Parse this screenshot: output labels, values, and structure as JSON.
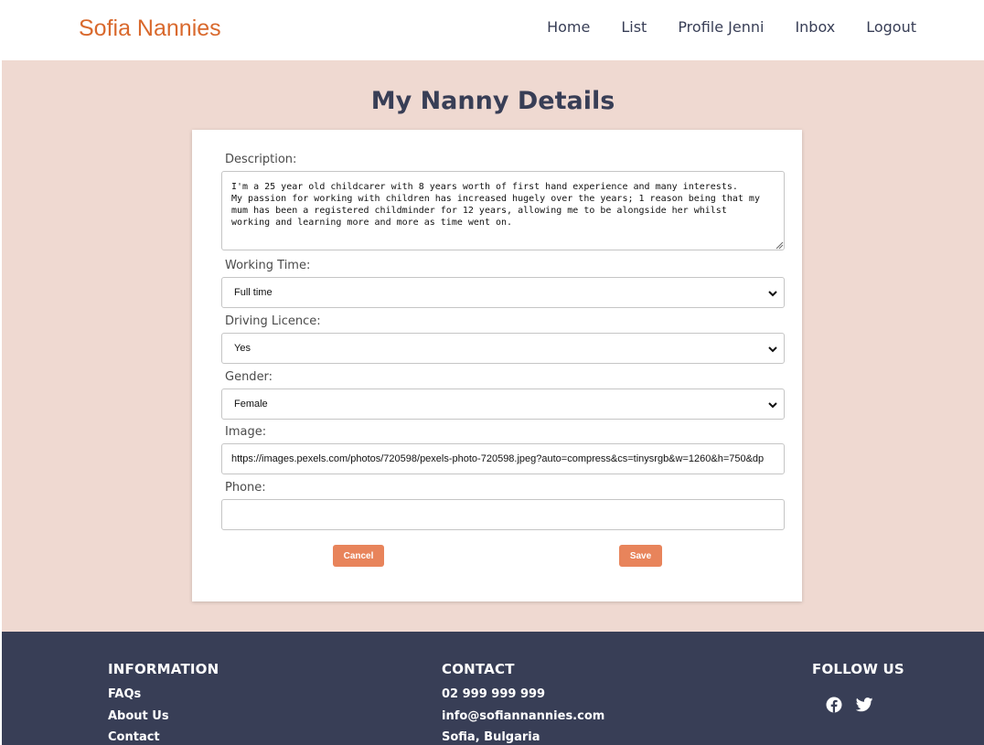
{
  "header": {
    "brand": "Sofia Nannies",
    "nav": [
      "Home",
      "List",
      "Profile Jenni",
      "Inbox",
      "Logout"
    ]
  },
  "main": {
    "title": "My Nanny Details",
    "form": {
      "description_label": "Description:",
      "description_value": "I'm a 25 year old childcarer with 8 years worth of first hand experience and many interests.\nMy passion for working with children has increased hugely over the years; 1 reason being that my\nmum has been a registered childminder for 12 years, allowing me to be alongside her whilst\nworking and learning more and more as time went on.",
      "working_time_label": "Working Time:",
      "working_time_value": "Full time",
      "driving_licence_label": "Driving Licence:",
      "driving_licence_value": "Yes",
      "gender_label": "Gender:",
      "gender_value": "Female",
      "image_label": "Image:",
      "image_value": "https://images.pexels.com/photos/720598/pexels-photo-720598.jpeg?auto=compress&cs=tinysrgb&w=1260&h=750&dp",
      "phone_label": "Phone:",
      "phone_value": "",
      "cancel_label": "Cancel",
      "save_label": "Save"
    }
  },
  "footer": {
    "information": {
      "heading": "INFORMATION",
      "links": [
        "FAQs",
        "About Us",
        "Contact"
      ]
    },
    "contact": {
      "heading": "CONTACT",
      "phone": "02 999 999 999",
      "email": "info@sofiannannies.com",
      "location": "Sofia, Bulgaria"
    },
    "follow": {
      "heading": "FOLLOW US",
      "icons": [
        "facebook-icon",
        "twitter-icon"
      ]
    }
  },
  "colors": {
    "brand": "#d9692d",
    "navy": "#383e56",
    "page_bg": "#efd9d1",
    "button": "#e8845b"
  }
}
